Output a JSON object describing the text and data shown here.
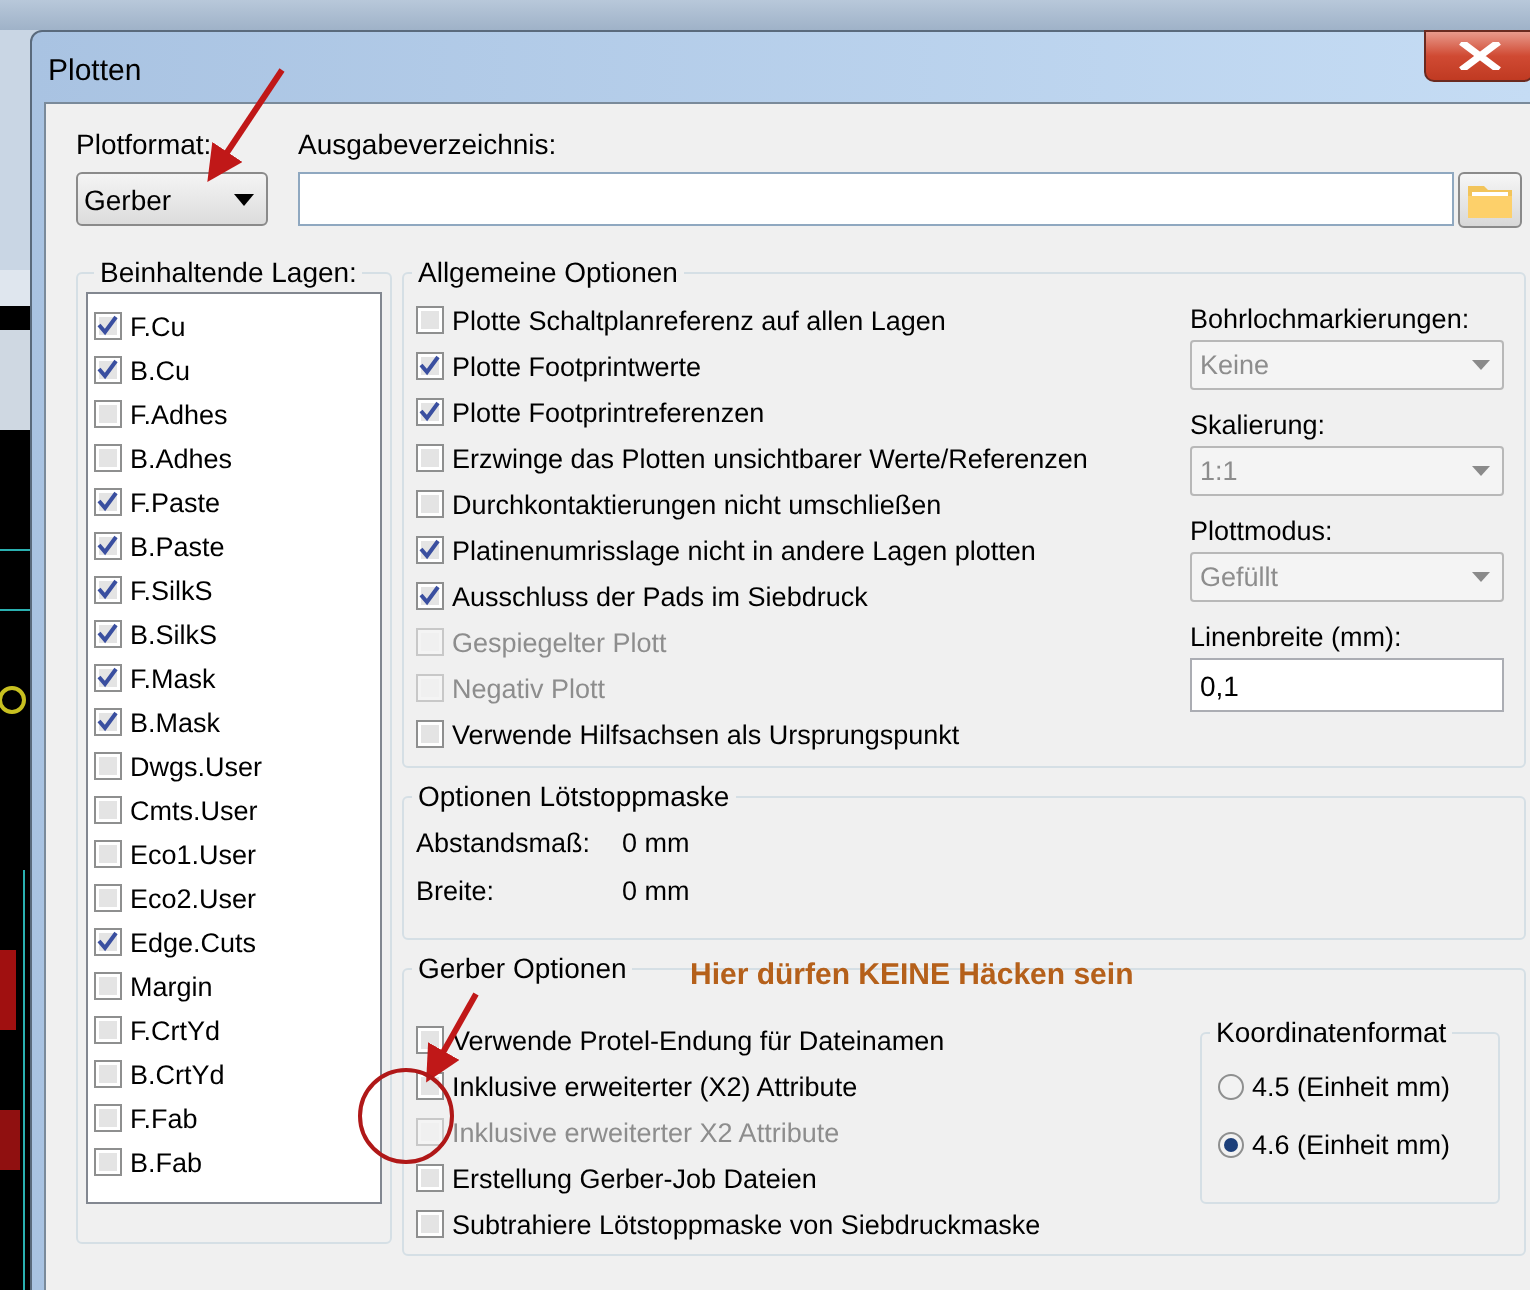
{
  "window": {
    "title": "Plotten"
  },
  "plot_format": {
    "label": "Plotformat:",
    "value": "Gerber"
  },
  "output_dir": {
    "label": "Ausgabeverzeichnis:"
  },
  "layers": {
    "title": "Beinhaltende Lagen:",
    "items": [
      {
        "label": "F.Cu",
        "checked": true
      },
      {
        "label": "B.Cu",
        "checked": true
      },
      {
        "label": "F.Adhes",
        "checked": false
      },
      {
        "label": "B.Adhes",
        "checked": false
      },
      {
        "label": "F.Paste",
        "checked": true
      },
      {
        "label": "B.Paste",
        "checked": true
      },
      {
        "label": "F.SilkS",
        "checked": true
      },
      {
        "label": "B.SilkS",
        "checked": true
      },
      {
        "label": "F.Mask",
        "checked": true
      },
      {
        "label": "B.Mask",
        "checked": true
      },
      {
        "label": "Dwgs.User",
        "checked": false
      },
      {
        "label": "Cmts.User",
        "checked": false
      },
      {
        "label": "Eco1.User",
        "checked": false
      },
      {
        "label": "Eco2.User",
        "checked": false
      },
      {
        "label": "Edge.Cuts",
        "checked": true
      },
      {
        "label": "Margin",
        "checked": false
      },
      {
        "label": "F.CrtYd",
        "checked": false
      },
      {
        "label": "B.CrtYd",
        "checked": false
      },
      {
        "label": "F.Fab",
        "checked": false
      },
      {
        "label": "B.Fab",
        "checked": false
      }
    ]
  },
  "general_options": {
    "title": "Allgemeine Optionen",
    "options": [
      {
        "label": "Plotte Schaltplanreferenz auf allen Lagen",
        "checked": false,
        "disabled": false
      },
      {
        "label": "Plotte Footprintwerte",
        "checked": true,
        "disabled": false
      },
      {
        "label": "Plotte Footprintreferenzen",
        "checked": true,
        "disabled": false
      },
      {
        "label": "Erzwinge das Plotten unsichtbarer Werte/Referenzen",
        "checked": false,
        "disabled": false
      },
      {
        "label": "Durchkontaktierungen nicht umschließen",
        "checked": false,
        "disabled": false
      },
      {
        "label": "Platinenumrisslage nicht in andere Lagen plotten",
        "checked": true,
        "disabled": false
      },
      {
        "label": "Ausschluss der Pads im Siebdruck",
        "checked": true,
        "disabled": false
      },
      {
        "label": "Gespiegelter Plott",
        "checked": false,
        "disabled": true
      },
      {
        "label": "Negativ Plott",
        "checked": false,
        "disabled": true
      },
      {
        "label": "Verwende Hilfsachsen als Ursprungspunkt",
        "checked": false,
        "disabled": false
      }
    ],
    "fields": [
      {
        "label": "Bohrlochmarkierungen:",
        "kind": "select",
        "value": "Keine",
        "disabled": true
      },
      {
        "label": "Skalierung:",
        "kind": "select",
        "value": "1:1",
        "disabled": true
      },
      {
        "label": "Plottmodus:",
        "kind": "select",
        "value": "Gefüllt",
        "disabled": true
      },
      {
        "label": "Linenbreite (mm):",
        "kind": "input",
        "value": "0,1",
        "disabled": false
      }
    ]
  },
  "mask_options": {
    "title": "Optionen Lötstoppmaske",
    "rows": [
      {
        "label": "Abstandsmaß:",
        "value": "0 mm"
      },
      {
        "label": "Breite:",
        "value": "0 mm"
      }
    ]
  },
  "gerber_options": {
    "title": "Gerber Optionen",
    "options": [
      {
        "label": "Verwende Protel-Endung für Dateinamen",
        "checked": false,
        "disabled": false
      },
      {
        "label": "Inklusive erweiterter (X2) Attribute",
        "checked": false,
        "disabled": false
      },
      {
        "label": "Inklusive erweiterter X2 Attribute",
        "checked": false,
        "disabled": true
      },
      {
        "label": "Erstellung Gerber-Job Dateien",
        "checked": false,
        "disabled": false
      },
      {
        "label": "Subtrahiere Lötstoppmaske von Siebdruckmaske",
        "checked": false,
        "disabled": false
      }
    ],
    "coordinate_format": {
      "title": "Koordinatenformat",
      "choices": [
        {
          "label": "4.5 (Einheit mm)",
          "selected": false
        },
        {
          "label": "4.6 (Einheit mm)",
          "selected": true
        }
      ]
    }
  },
  "annotation": {
    "note": "Hier dürfen KEINE Häcken sein"
  }
}
